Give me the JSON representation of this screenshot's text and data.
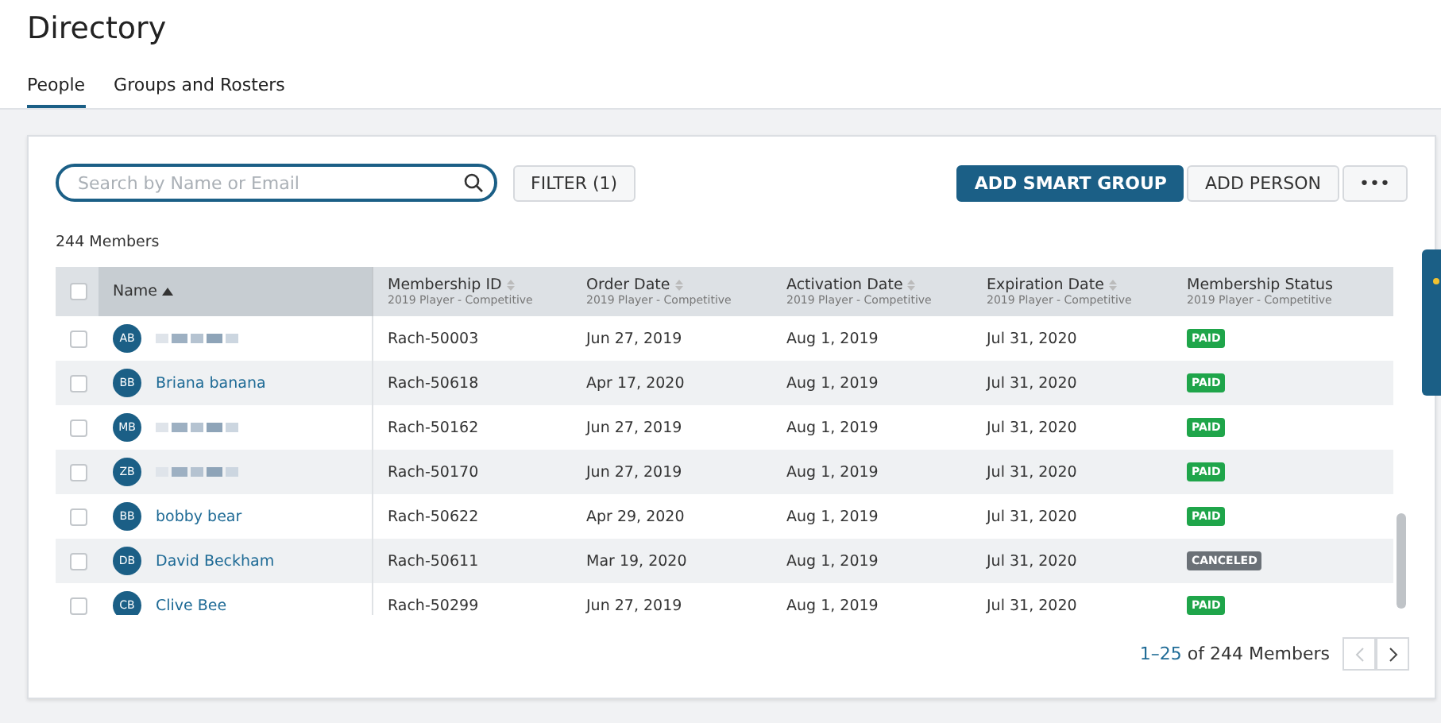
{
  "page": {
    "title": "Directory"
  },
  "tabs": [
    {
      "label": "People",
      "selected": true
    },
    {
      "label": "Groups and Rosters",
      "selected": false
    }
  ],
  "search": {
    "placeholder": "Search by Name or Email"
  },
  "filter_button": "FILTER (1)",
  "actions": {
    "primary": "ADD SMART GROUP",
    "secondary": "ADD PERSON",
    "more": "•••"
  },
  "member_count": "244 Members",
  "table": {
    "select_all_checked": false,
    "columns": [
      {
        "label": "Name",
        "sortable": true,
        "sorted": true
      },
      {
        "label": "Membership ID",
        "sortable": true,
        "sorted": false,
        "sub": "2019 Player - Competitive"
      },
      {
        "label": "Order Date",
        "sortable": true,
        "sorted": false,
        "sub": "2019 Player - Competitive"
      },
      {
        "label": "Activation Date",
        "sortable": true,
        "sorted": false,
        "sub": "2019 Player - Competitive"
      },
      {
        "label": "Expiration Date",
        "sortable": true,
        "sorted": false,
        "sub": "2019 Player - Competitive"
      },
      {
        "label": "Membership Status",
        "sortable": false,
        "sorted": false,
        "sub": "2019 Player - Competitive"
      }
    ],
    "rows": [
      {
        "checked": false,
        "initials": "AB",
        "name_hidden": true,
        "id": "Rach-50003",
        "order": "Jun 27, 2019",
        "activation": "Aug 1, 2019",
        "expiration": "Jul 31, 2020",
        "status": {
          "label": "PAID",
          "kind": "paid"
        }
      },
      {
        "checked": false,
        "initials": "BB",
        "name": "Briana banana",
        "id": "Rach-50618",
        "order": "Apr 17, 2020",
        "activation": "Aug 1, 2019",
        "expiration": "Jul 31, 2020",
        "status": {
          "label": "PAID",
          "kind": "paid"
        }
      },
      {
        "checked": false,
        "initials": "MB",
        "name_hidden": true,
        "id": "Rach-50162",
        "order": "Jun 27, 2019",
        "activation": "Aug 1, 2019",
        "expiration": "Jul 31, 2020",
        "status": {
          "label": "PAID",
          "kind": "paid"
        }
      },
      {
        "checked": false,
        "initials": "ZB",
        "name_hidden": true,
        "id": "Rach-50170",
        "order": "Jun 27, 2019",
        "activation": "Aug 1, 2019",
        "expiration": "Jul 31, 2020",
        "status": {
          "label": "PAID",
          "kind": "paid"
        }
      },
      {
        "checked": false,
        "initials": "BB",
        "name": "bobby bear",
        "id": "Rach-50622",
        "order": "Apr 29, 2020",
        "activation": "Aug 1, 2019",
        "expiration": "Jul 31, 2020",
        "status": {
          "label": "PAID",
          "kind": "paid"
        }
      },
      {
        "checked": false,
        "initials": "DB",
        "name": "David Beckham",
        "id": "Rach-50611",
        "order": "Mar 19, 2020",
        "activation": "Aug 1, 2019",
        "expiration": "Jul 31, 2020",
        "status": {
          "label": "CANCELED",
          "kind": "canceled"
        }
      },
      {
        "checked": false,
        "initials": "CB",
        "name": "Clive Bee",
        "id": "Rach-50299",
        "order": "Jun 27, 2019",
        "activation": "Aug 1, 2019",
        "expiration": "Jul 31, 2020",
        "status": {
          "label": "PAID",
          "kind": "paid"
        }
      }
    ]
  },
  "pagination": {
    "range": "1–25",
    "total": "of 244 Members",
    "prev_disabled": true,
    "next_disabled": false
  }
}
